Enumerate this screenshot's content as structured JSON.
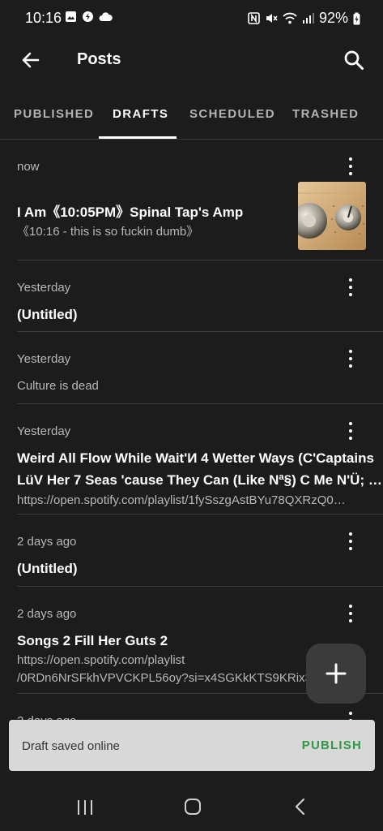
{
  "status_bar": {
    "time": "10:16",
    "battery": "92%"
  },
  "app_bar": {
    "title": "Posts"
  },
  "tabs": [
    {
      "label": "PUBLISHED"
    },
    {
      "label": "DRAFTS"
    },
    {
      "label": "SCHEDULED"
    },
    {
      "label": "TRASHED"
    }
  ],
  "posts": [
    {
      "date": "now",
      "title": "I Am《10:05PM》Spinal Tap's Amp",
      "excerpt": "《10:16 - this is so fuckin dumb》"
    },
    {
      "date": "Yesterday",
      "title": "(Untitled)"
    },
    {
      "date": "Yesterday",
      "excerpt": "Culture is dead"
    },
    {
      "date": "Yesterday",
      "title": "Weird All Flow While Wait'И 4 Wetter Ways (C'Captains",
      "title2": "LüV Her 7 Seas 'cause They Can (Like Nª§) C Me N'Ü; …",
      "excerpt": "https://open.spotify.com/playlist/1fySszgAstBYu78QXRzQ0…"
    },
    {
      "date": "2 days ago",
      "title": "(Untitled)"
    },
    {
      "date": "2 days ago",
      "title": "Songs 2 Fill Her Guts 2",
      "excerpt": "https://open.spotify.com/playlist",
      "excerpt2": "/0RDn6NrSFkhVPVCKPL56oy?si=x4SGKkKTS9KRix3"
    },
    {
      "date": "2 days ago"
    }
  ],
  "snackbar": {
    "message": "Draft saved online",
    "action": "PUBLISH"
  },
  "colors": {
    "background": "#1c1c1c",
    "accent": "#2e9a46",
    "snackbar": "#d8d8d8",
    "fab": "#3b3b3b"
  }
}
